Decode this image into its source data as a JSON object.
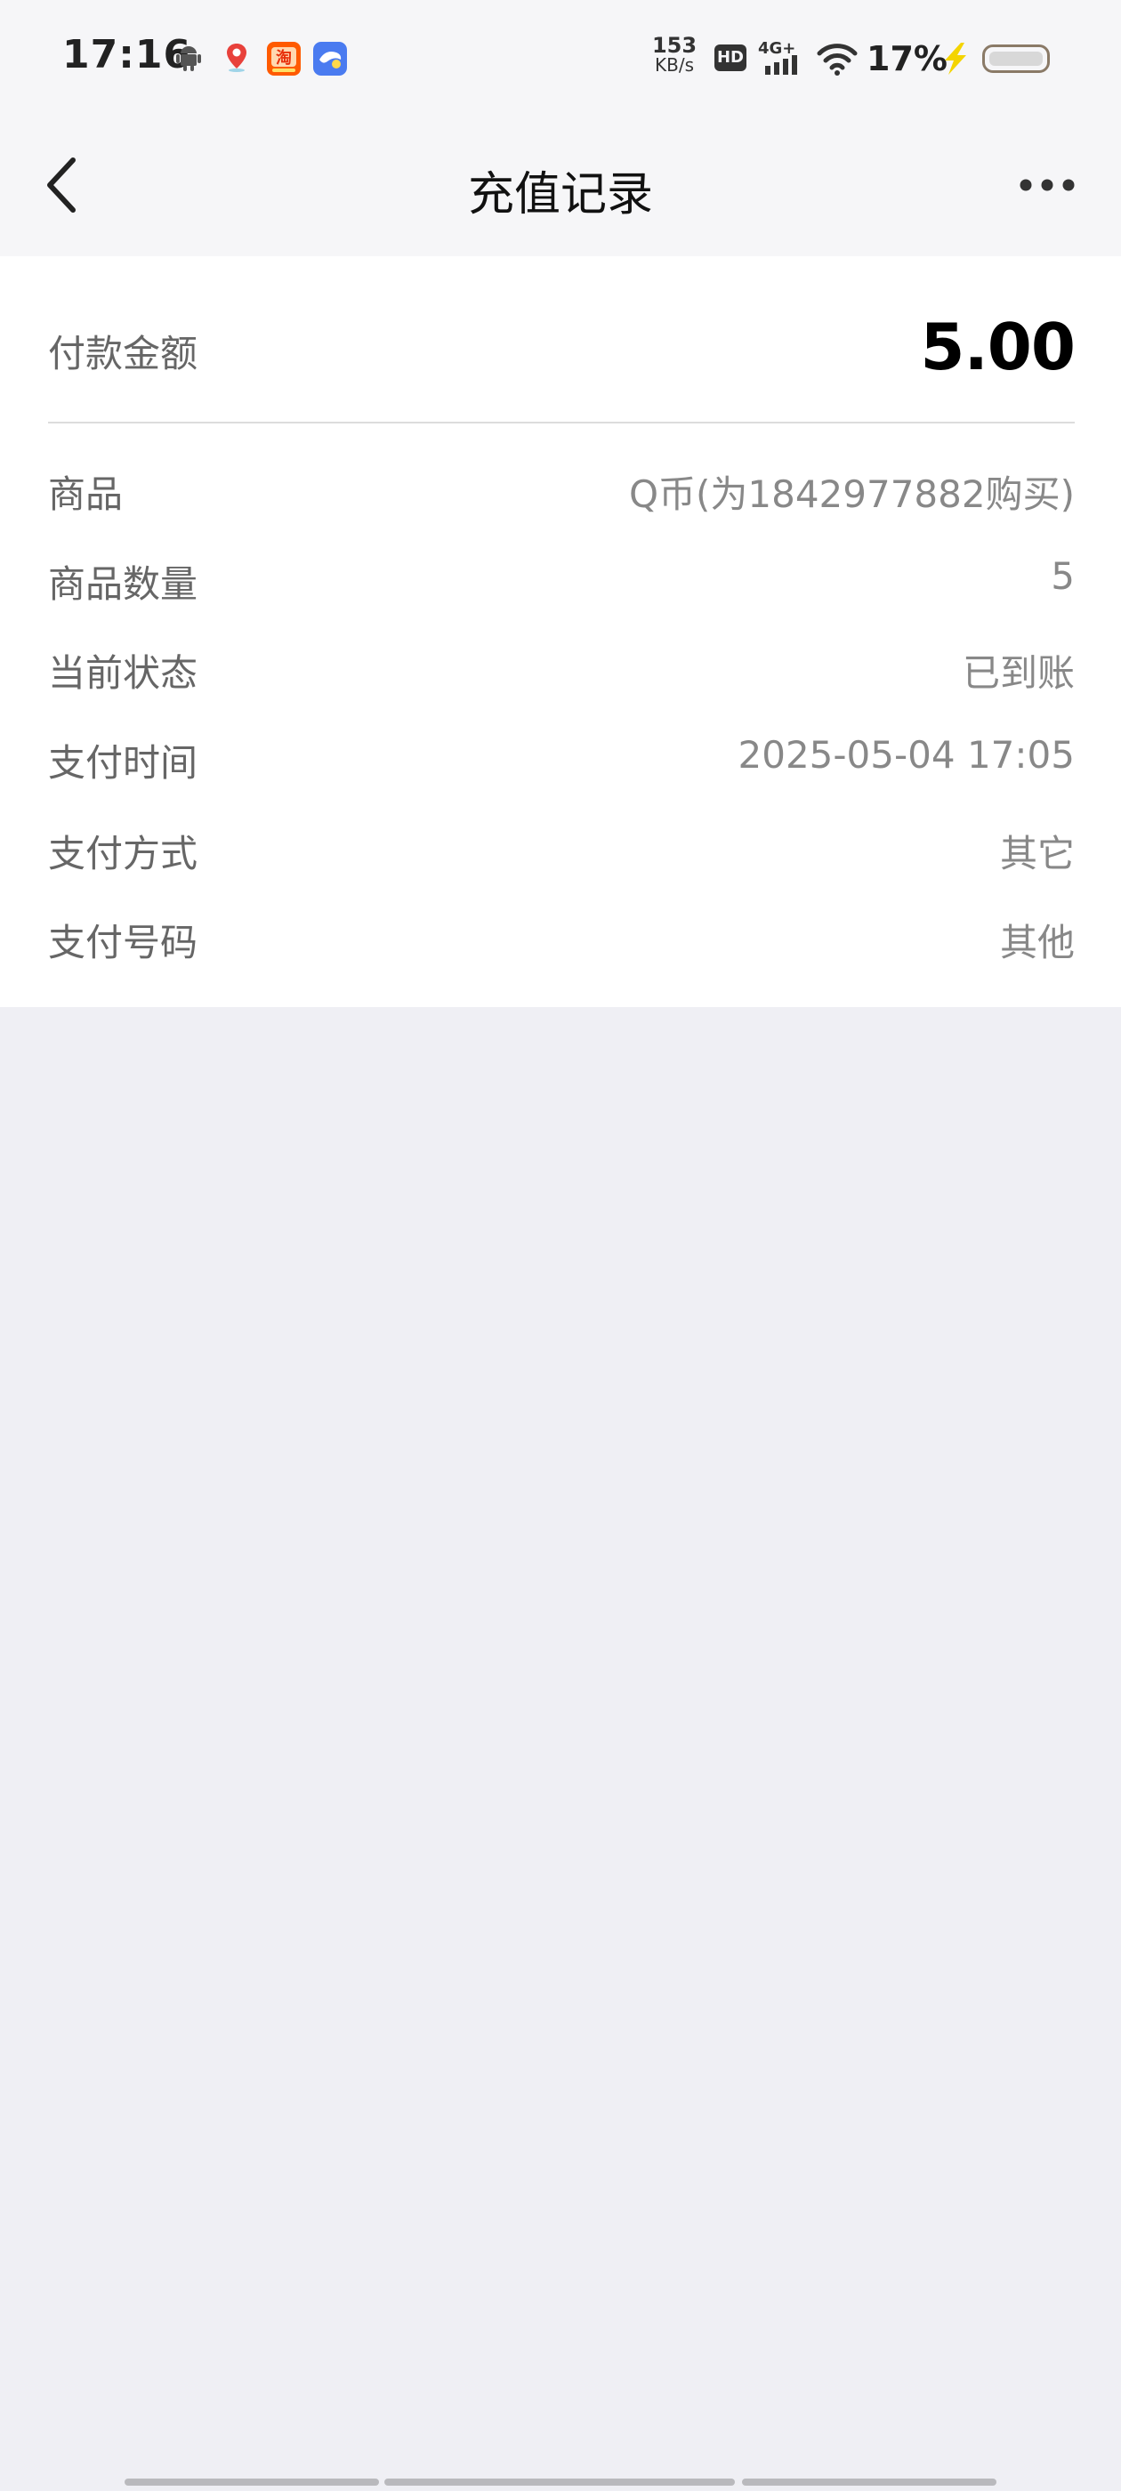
{
  "status_bar": {
    "time": "17:16",
    "net_speed_value": "153",
    "net_speed_unit": "KB/s",
    "hd_label": "HD",
    "network_type": "4G+",
    "battery_percent": "17%",
    "icons": [
      "android-icon",
      "map-icon",
      "taobao-icon",
      "app-icon",
      "hd-icon",
      "signal-icon",
      "wifi-icon",
      "charging-icon",
      "battery-icon"
    ]
  },
  "header": {
    "title": "充值记录",
    "back_icon": "chevron-left-icon",
    "more_icon": "more-dots-icon"
  },
  "payment": {
    "amount_label": "付款金额",
    "amount_value": "5.00"
  },
  "details": [
    {
      "label": "商品",
      "value": "Q币(为1842977882购买)"
    },
    {
      "label": "商品数量",
      "value": "5"
    },
    {
      "label": "当前状态",
      "value": "已到账"
    },
    {
      "label": "支付时间",
      "value": "2025-05-04 17:05"
    },
    {
      "label": "支付方式",
      "value": "其它"
    },
    {
      "label": "支付号码",
      "value": "其他"
    }
  ],
  "colors": {
    "page_background": "#efeff4",
    "header_background": "#f6f6f8",
    "card_background": "#ffffff",
    "label_text": "#666666",
    "value_text": "#888888",
    "amount_text": "#000000"
  }
}
